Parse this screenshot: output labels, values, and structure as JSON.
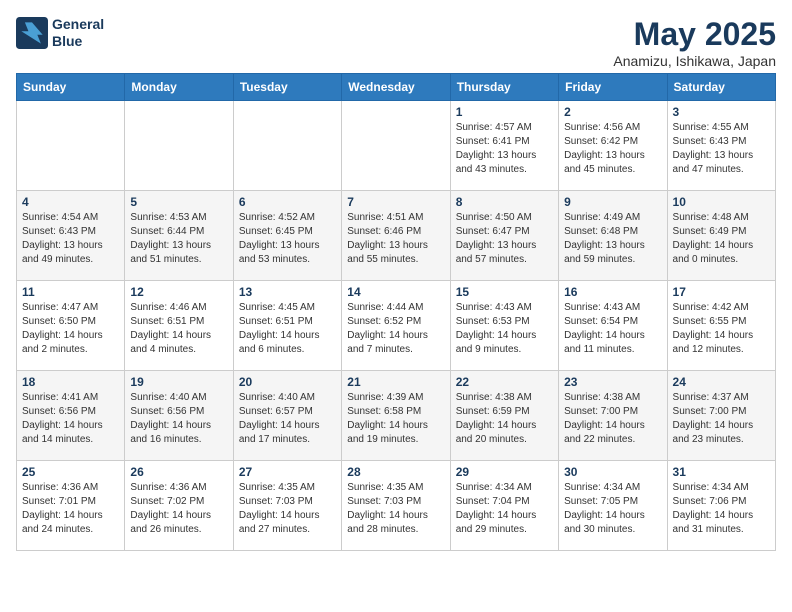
{
  "logo": {
    "line1": "General",
    "line2": "Blue"
  },
  "title": "May 2025",
  "subtitle": "Anamizu, Ishikawa, Japan",
  "headers": [
    "Sunday",
    "Monday",
    "Tuesday",
    "Wednesday",
    "Thursday",
    "Friday",
    "Saturday"
  ],
  "weeks": [
    [
      {
        "day": "",
        "info": ""
      },
      {
        "day": "",
        "info": ""
      },
      {
        "day": "",
        "info": ""
      },
      {
        "day": "",
        "info": ""
      },
      {
        "day": "1",
        "info": "Sunrise: 4:57 AM\nSunset: 6:41 PM\nDaylight: 13 hours\nand 43 minutes."
      },
      {
        "day": "2",
        "info": "Sunrise: 4:56 AM\nSunset: 6:42 PM\nDaylight: 13 hours\nand 45 minutes."
      },
      {
        "day": "3",
        "info": "Sunrise: 4:55 AM\nSunset: 6:43 PM\nDaylight: 13 hours\nand 47 minutes."
      }
    ],
    [
      {
        "day": "4",
        "info": "Sunrise: 4:54 AM\nSunset: 6:43 PM\nDaylight: 13 hours\nand 49 minutes."
      },
      {
        "day": "5",
        "info": "Sunrise: 4:53 AM\nSunset: 6:44 PM\nDaylight: 13 hours\nand 51 minutes."
      },
      {
        "day": "6",
        "info": "Sunrise: 4:52 AM\nSunset: 6:45 PM\nDaylight: 13 hours\nand 53 minutes."
      },
      {
        "day": "7",
        "info": "Sunrise: 4:51 AM\nSunset: 6:46 PM\nDaylight: 13 hours\nand 55 minutes."
      },
      {
        "day": "8",
        "info": "Sunrise: 4:50 AM\nSunset: 6:47 PM\nDaylight: 13 hours\nand 57 minutes."
      },
      {
        "day": "9",
        "info": "Sunrise: 4:49 AM\nSunset: 6:48 PM\nDaylight: 13 hours\nand 59 minutes."
      },
      {
        "day": "10",
        "info": "Sunrise: 4:48 AM\nSunset: 6:49 PM\nDaylight: 14 hours\nand 0 minutes."
      }
    ],
    [
      {
        "day": "11",
        "info": "Sunrise: 4:47 AM\nSunset: 6:50 PM\nDaylight: 14 hours\nand 2 minutes."
      },
      {
        "day": "12",
        "info": "Sunrise: 4:46 AM\nSunset: 6:51 PM\nDaylight: 14 hours\nand 4 minutes."
      },
      {
        "day": "13",
        "info": "Sunrise: 4:45 AM\nSunset: 6:51 PM\nDaylight: 14 hours\nand 6 minutes."
      },
      {
        "day": "14",
        "info": "Sunrise: 4:44 AM\nSunset: 6:52 PM\nDaylight: 14 hours\nand 7 minutes."
      },
      {
        "day": "15",
        "info": "Sunrise: 4:43 AM\nSunset: 6:53 PM\nDaylight: 14 hours\nand 9 minutes."
      },
      {
        "day": "16",
        "info": "Sunrise: 4:43 AM\nSunset: 6:54 PM\nDaylight: 14 hours\nand 11 minutes."
      },
      {
        "day": "17",
        "info": "Sunrise: 4:42 AM\nSunset: 6:55 PM\nDaylight: 14 hours\nand 12 minutes."
      }
    ],
    [
      {
        "day": "18",
        "info": "Sunrise: 4:41 AM\nSunset: 6:56 PM\nDaylight: 14 hours\nand 14 minutes."
      },
      {
        "day": "19",
        "info": "Sunrise: 4:40 AM\nSunset: 6:56 PM\nDaylight: 14 hours\nand 16 minutes."
      },
      {
        "day": "20",
        "info": "Sunrise: 4:40 AM\nSunset: 6:57 PM\nDaylight: 14 hours\nand 17 minutes."
      },
      {
        "day": "21",
        "info": "Sunrise: 4:39 AM\nSunset: 6:58 PM\nDaylight: 14 hours\nand 19 minutes."
      },
      {
        "day": "22",
        "info": "Sunrise: 4:38 AM\nSunset: 6:59 PM\nDaylight: 14 hours\nand 20 minutes."
      },
      {
        "day": "23",
        "info": "Sunrise: 4:38 AM\nSunset: 7:00 PM\nDaylight: 14 hours\nand 22 minutes."
      },
      {
        "day": "24",
        "info": "Sunrise: 4:37 AM\nSunset: 7:00 PM\nDaylight: 14 hours\nand 23 minutes."
      }
    ],
    [
      {
        "day": "25",
        "info": "Sunrise: 4:36 AM\nSunset: 7:01 PM\nDaylight: 14 hours\nand 24 minutes."
      },
      {
        "day": "26",
        "info": "Sunrise: 4:36 AM\nSunset: 7:02 PM\nDaylight: 14 hours\nand 26 minutes."
      },
      {
        "day": "27",
        "info": "Sunrise: 4:35 AM\nSunset: 7:03 PM\nDaylight: 14 hours\nand 27 minutes."
      },
      {
        "day": "28",
        "info": "Sunrise: 4:35 AM\nSunset: 7:03 PM\nDaylight: 14 hours\nand 28 minutes."
      },
      {
        "day": "29",
        "info": "Sunrise: 4:34 AM\nSunset: 7:04 PM\nDaylight: 14 hours\nand 29 minutes."
      },
      {
        "day": "30",
        "info": "Sunrise: 4:34 AM\nSunset: 7:05 PM\nDaylight: 14 hours\nand 30 minutes."
      },
      {
        "day": "31",
        "info": "Sunrise: 4:34 AM\nSunset: 7:06 PM\nDaylight: 14 hours\nand 31 minutes."
      }
    ]
  ]
}
